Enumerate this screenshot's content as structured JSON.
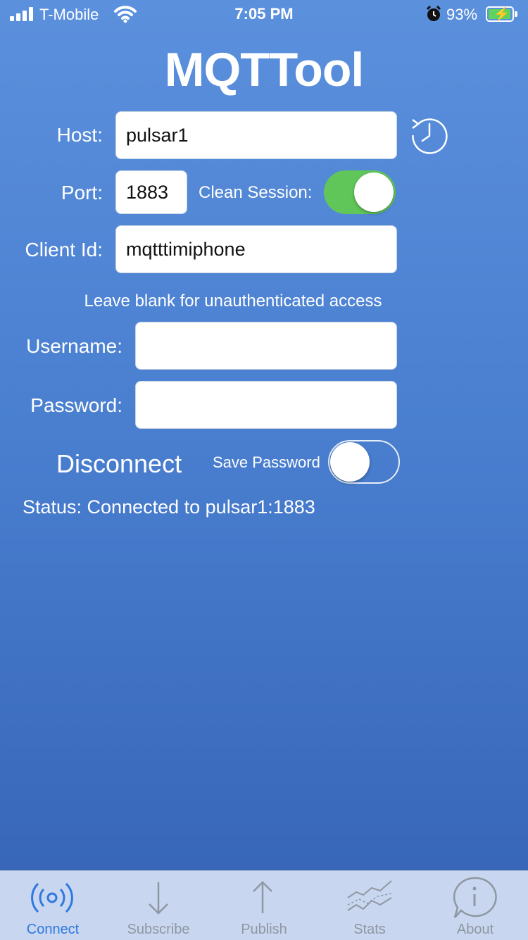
{
  "status_bar": {
    "carrier": "T-Mobile",
    "time": "7:05 PM",
    "battery": "93%"
  },
  "app_title": "MQTTool",
  "form": {
    "host_label": "Host:",
    "host_value": "pulsar1",
    "port_label": "Port:",
    "port_value": "1883",
    "clean_session_label": "Clean Session:",
    "clean_session_on": true,
    "client_id_label": "Client Id:",
    "client_id_value": "mqtttimiphone",
    "auth_hint": "Leave blank for unauthenticated access",
    "username_label": "Username:",
    "username_value": "",
    "password_label": "Password:",
    "password_value": ""
  },
  "actions": {
    "disconnect_label": "Disconnect",
    "save_password_label": "Save Password",
    "save_password_on": false
  },
  "status_text": "Status: Connected to pulsar1:1883",
  "tabs": [
    {
      "label": "Connect",
      "icon": "connect-icon",
      "active": true
    },
    {
      "label": "Subscribe",
      "icon": "arrow-down-icon",
      "active": false
    },
    {
      "label": "Publish",
      "icon": "arrow-up-icon",
      "active": false
    },
    {
      "label": "Stats",
      "icon": "stats-icon",
      "active": false
    },
    {
      "label": "About",
      "icon": "info-icon",
      "active": false
    }
  ],
  "colors": {
    "background_top": "#5b90dd",
    "background_bottom": "#3563b5",
    "toggle_on": "#61c65a",
    "tab_active": "#2f78e0",
    "tab_inactive": "#8f97a3"
  }
}
